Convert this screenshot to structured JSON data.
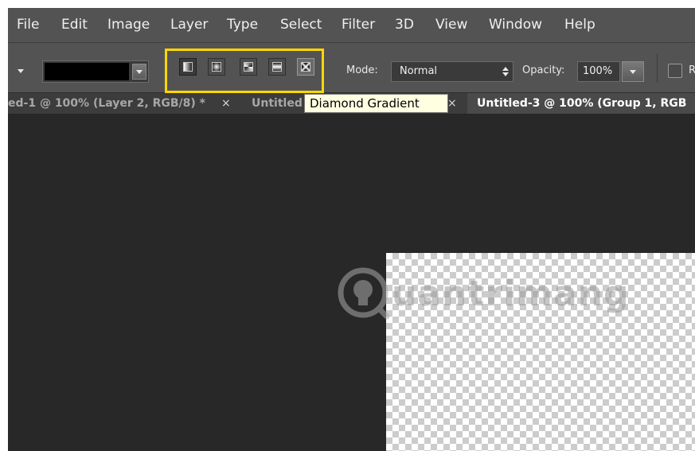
{
  "menu": {
    "items": [
      "File",
      "Edit",
      "Image",
      "Layer",
      "Type",
      "Select",
      "Filter",
      "3D",
      "View",
      "Window",
      "Help"
    ]
  },
  "options": {
    "gradient_color": "#000000",
    "gradient_types": [
      {
        "name": "Linear Gradient",
        "icon": "linear-gradient-icon"
      },
      {
        "name": "Radial Gradient",
        "icon": "radial-gradient-icon"
      },
      {
        "name": "Angle Gradient",
        "icon": "angle-gradient-icon"
      },
      {
        "name": "Reflected Gradient",
        "icon": "reflected-gradient-icon"
      },
      {
        "name": "Diamond Gradient",
        "icon": "diamond-gradient-icon"
      }
    ],
    "mode_label": "Mode:",
    "mode_value": "Normal",
    "opacity_label": "Opacity:",
    "opacity_value": "100%",
    "reverse_label_peek": "R",
    "highlight_color": "#ffd700"
  },
  "tabs": [
    {
      "title": "ed-1 @ 100% (Layer 2, RGB/8) *",
      "close": "×"
    },
    {
      "title": "Untitled",
      "close": "×"
    },
    {
      "title": "Untitled-3 @ 100% (Group 1, RGB",
      "close": ""
    }
  ],
  "tooltip": {
    "text": "Diamond Gradient"
  },
  "watermark": {
    "text": "uantrimang"
  }
}
